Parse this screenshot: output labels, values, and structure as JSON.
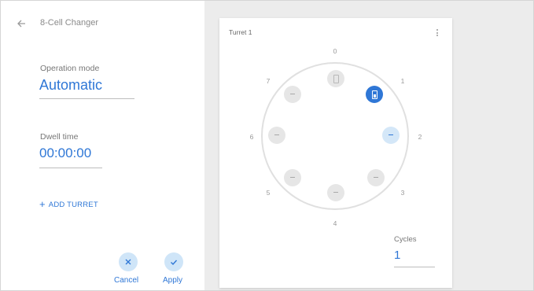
{
  "header": {
    "title": "8-Cell Changer",
    "back_icon": "arrow-left-icon"
  },
  "settings": {
    "operation_mode": {
      "label": "Operation mode",
      "value": "Automatic"
    },
    "dwell_time": {
      "label": "Dwell time",
      "value": "00:00:00"
    },
    "add_turret_label": "ADD TURRET",
    "add_turret_icon": "+"
  },
  "actions": {
    "cancel": {
      "label": "Cancel",
      "icon": "close-icon"
    },
    "apply": {
      "label": "Apply",
      "icon": "check-icon"
    }
  },
  "turret": {
    "title": "Turret 1",
    "menu_icon": "more-vert-icon",
    "positions": [
      {
        "number": "0",
        "state": "cuvette-empty"
      },
      {
        "number": "1",
        "state": "cuvette-selected"
      },
      {
        "number": "2",
        "state": "active"
      },
      {
        "number": "3",
        "state": "idle"
      },
      {
        "number": "4",
        "state": "idle"
      },
      {
        "number": "5",
        "state": "idle"
      },
      {
        "number": "6",
        "state": "idle"
      },
      {
        "number": "7",
        "state": "idle"
      }
    ],
    "cycles": {
      "label": "Cycles",
      "value": "1"
    }
  },
  "colors": {
    "accent": "#2f77d6",
    "accent_light": "#d4e7f8",
    "idle": "#e6e6e6"
  }
}
